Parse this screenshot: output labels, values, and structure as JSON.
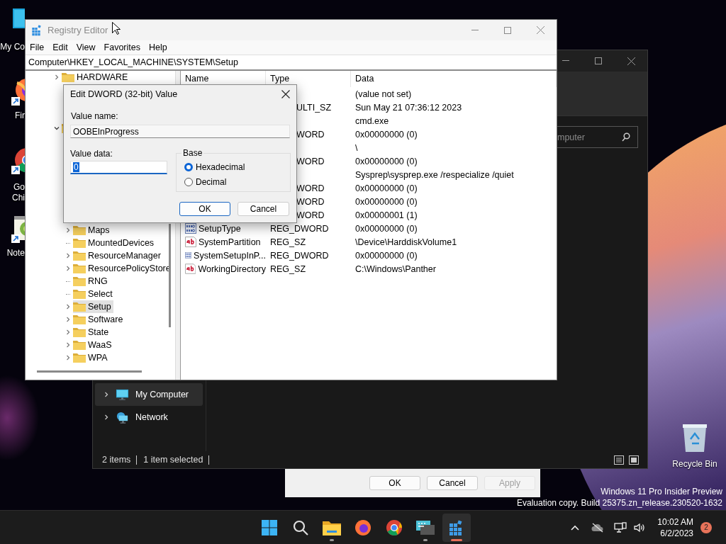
{
  "desktop_icons": [
    {
      "kind": "computer",
      "lines": [
        "My Co"
      ],
      "shortcut": false
    },
    {
      "kind": "firefox",
      "lines": [
        "Fir"
      ],
      "shortcut": true
    },
    {
      "kind": "chrome",
      "lines": [
        "Go",
        "Chi"
      ],
      "shortcut": true
    },
    {
      "kind": "notepad",
      "lines": [
        "Note"
      ],
      "shortcut": true
    }
  ],
  "recycle_bin": {
    "label": "Recycle Bin"
  },
  "explorer": {
    "search_placeholder": "mputer",
    "nav": [
      {
        "kind": "computer",
        "label": "My Computer",
        "selected": true
      },
      {
        "kind": "network",
        "label": "Network",
        "selected": false
      }
    ],
    "status": [
      "2 items",
      "1 item selected"
    ]
  },
  "properties_dialog": {
    "buttons": [
      {
        "label": "OK",
        "disabled": false
      },
      {
        "label": "Cancel",
        "disabled": false
      },
      {
        "label": "Apply",
        "disabled": true
      }
    ]
  },
  "registry_editor": {
    "title": "Registry Editor",
    "menu": [
      "File",
      "Edit",
      "View",
      "Favorites",
      "Help"
    ],
    "address": "Computer\\HKEY_LOCAL_MACHINE\\SYSTEM\\Setup",
    "tree": [
      {
        "label": "HARDWARE",
        "expanded": false,
        "selected": false
      },
      {
        "expanded": true,
        "children": [
          {
            "label": "Maps",
            "expanded": false,
            "selected": false
          },
          {
            "label": "MountedDevices",
            "selected": false
          },
          {
            "label": "ResourceManager",
            "expanded": false,
            "selected": false
          },
          {
            "label": "ResourcePolicyStore",
            "expanded": false,
            "selected": false
          },
          {
            "label": "RNG",
            "selected": false
          },
          {
            "label": "Select",
            "selected": false
          },
          {
            "label": "Setup",
            "expanded": false,
            "selected": true
          },
          {
            "label": "Software",
            "expanded": false,
            "selected": false
          },
          {
            "label": "State",
            "expanded": false,
            "selected": false
          },
          {
            "label": "WaaS",
            "expanded": false,
            "selected": false
          },
          {
            "label": "WPA",
            "expanded": false,
            "selected": false
          }
        ]
      }
    ],
    "columns": [
      "Name",
      "Type",
      "Data"
    ],
    "rows": [
      {
        "data": "(value not set)"
      },
      {
        "type": "ULTI_SZ",
        "data": "Sun May 21 07:36:12 2023"
      },
      {
        "data": "cmd.exe"
      },
      {
        "type": "WORD",
        "data": "0x00000000 (0)"
      },
      {
        "data": "\\"
      },
      {
        "type": "WORD",
        "data": "0x00000000 (0)"
      },
      {
        "data": "Sysprep\\sysprep.exe /respecialize /quiet"
      },
      {
        "type": "WORD",
        "data": "0x00000000 (0)"
      },
      {
        "type": "WORD",
        "data": "0x00000000 (0)"
      },
      {
        "type": "WORD",
        "data": "0x00000001 (1)"
      },
      {
        "kind": "dword",
        "name": "SetupType",
        "type": "REG_DWORD",
        "data": "0x00000000 (0)"
      },
      {
        "kind": "sz",
        "name": "SystemPartition",
        "type": "REG_SZ",
        "data": "\\Device\\HarddiskVolume1"
      },
      {
        "kind": "dword",
        "name": "SystemSetupInP...",
        "type": "REG_DWORD",
        "data": "0x00000000 (0)"
      },
      {
        "kind": "sz",
        "name": "WorkingDirectory",
        "type": "REG_SZ",
        "data": "C:\\Windows\\Panther"
      }
    ]
  },
  "dword_dialog": {
    "title": "Edit DWORD (32-bit) Value",
    "value_name_label": "Value name:",
    "value_name": "OOBEInProgress",
    "value_data_label": "Value data:",
    "value_data": "0",
    "base_label": "Base",
    "bases": [
      {
        "label": "Hexadecimal",
        "selected": true
      },
      {
        "label": "Decimal",
        "selected": false
      }
    ],
    "buttons": [
      {
        "label": "OK",
        "default": true
      },
      {
        "label": "Cancel",
        "default": false
      }
    ]
  },
  "build_info": [
    "Windows 11 Pro Insider Preview",
    "Evaluation copy. Build 25375.zn_release.230520-1632"
  ],
  "taskbar": {
    "apps": [
      {
        "kind": "start",
        "running": false,
        "active": false
      },
      {
        "kind": "search",
        "running": false,
        "active": false
      },
      {
        "kind": "file-explorer",
        "running": true,
        "active": false
      },
      {
        "kind": "firefox",
        "running": false,
        "active": false
      },
      {
        "kind": "chrome",
        "running": false,
        "active": false
      },
      {
        "kind": "terminal",
        "running": true,
        "active": false
      },
      {
        "kind": "registry",
        "running": true,
        "active": true
      }
    ],
    "time": "10:02 AM",
    "date": "6/2/2023",
    "notification_count": "2"
  }
}
